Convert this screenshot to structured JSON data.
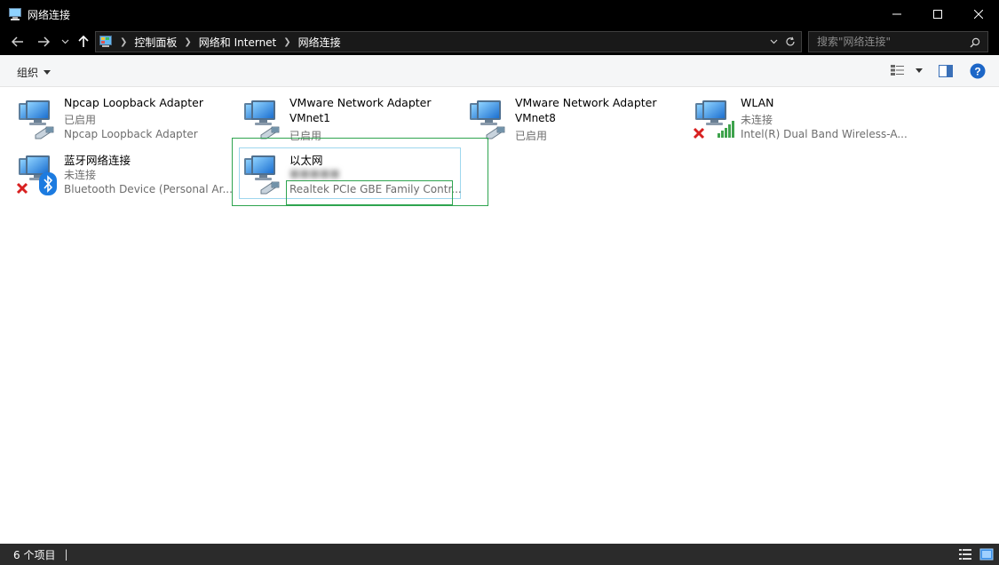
{
  "window": {
    "title": "网络连接"
  },
  "address": {
    "crumbs": [
      "控制面板",
      "网络和 Internet",
      "网络连接"
    ]
  },
  "search": {
    "placeholder": "搜索\"网络连接\""
  },
  "toolbar": {
    "organize_label": "组织"
  },
  "adapters": [
    {
      "name": "Npcap Loopback Adapter",
      "line2": "已启用",
      "line3": "Npcap Loopback Adapter",
      "status": "enabled"
    },
    {
      "name": "VMware Network Adapter",
      "line2": "VMnet1",
      "line3": "已启用",
      "status": "enabled"
    },
    {
      "name": "VMware Network Adapter",
      "line2": "VMnet8",
      "line3": "已启用",
      "status": "enabled"
    },
    {
      "name": "WLAN",
      "line2": "未连接",
      "line3": "Intel(R) Dual Band Wireless-A...",
      "status": "disconnected"
    },
    {
      "name": "蓝牙网络连接",
      "line2": "未连接",
      "line3": "Bluetooth Device (Personal Ar...",
      "status": "disconnected"
    },
    {
      "name": "以太网",
      "line2": "■■■■■",
      "line3": "Realtek PCIe GBE Family Contr...",
      "status": "selected"
    }
  ],
  "status": {
    "count_text": "6 个项目",
    "separator": "|"
  },
  "colors": {
    "titlebar": "#000000",
    "selection_outline": "#2ea44f",
    "selection_inner": "#9fd7ee",
    "icon_blue": "#1e73d2"
  }
}
